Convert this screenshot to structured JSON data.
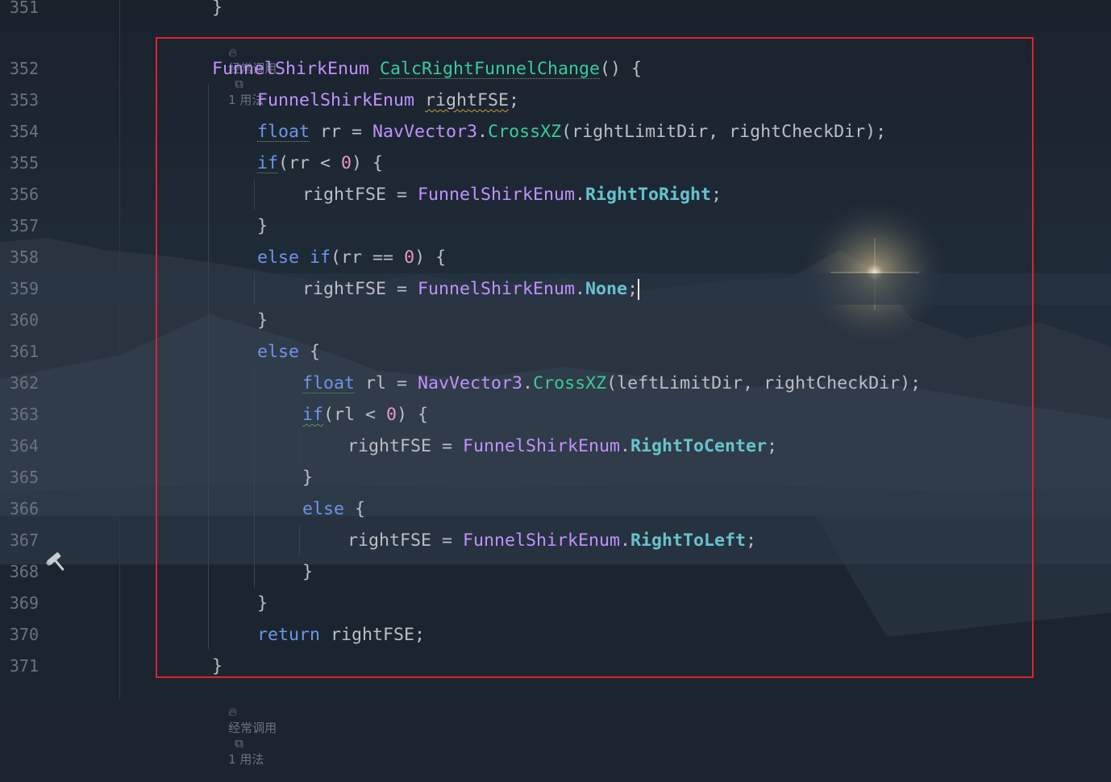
{
  "hints": [
    {
      "label": "经常调用",
      "usage": "1 用法"
    },
    {
      "label": "经常调用",
      "usage": "1 用法"
    }
  ],
  "lines": [
    {
      "num": "351",
      "text": "}"
    },
    {
      "num": "352",
      "text": "FunnelShirkEnum CalcRightFunnelChange() {"
    },
    {
      "num": "353",
      "text": "FunnelShirkEnum rightFSE;"
    },
    {
      "num": "354",
      "text": "float rr = NavVector3.CrossXZ(rightLimitDir, rightCheckDir);"
    },
    {
      "num": "355",
      "text": "if(rr < 0) {"
    },
    {
      "num": "356",
      "text": "rightFSE = FunnelShirkEnum.RightToRight;"
    },
    {
      "num": "357",
      "text": "}"
    },
    {
      "num": "358",
      "text": "else if(rr == 0) {"
    },
    {
      "num": "359",
      "text": "rightFSE = FunnelShirkEnum.None;"
    },
    {
      "num": "360",
      "text": "}"
    },
    {
      "num": "361",
      "text": "else {"
    },
    {
      "num": "362",
      "text": "float rl = NavVector3.CrossXZ(leftLimitDir, rightCheckDir);"
    },
    {
      "num": "363",
      "text": "if(rl < 0) {"
    },
    {
      "num": "364",
      "text": "rightFSE = FunnelShirkEnum.RightToCenter;"
    },
    {
      "num": "365",
      "text": "}"
    },
    {
      "num": "366",
      "text": "else {"
    },
    {
      "num": "367",
      "text": "rightFSE = FunnelShirkEnum.RightToLeft;"
    },
    {
      "num": "368",
      "text": "}"
    },
    {
      "num": "369",
      "text": "}"
    },
    {
      "num": "370",
      "text": "return rightFSE;"
    },
    {
      "num": "371",
      "text": "}"
    }
  ],
  "tokens": {
    "t352": [
      "FunnelShirkEnum",
      " ",
      "CalcRightFunnelChange",
      "() {"
    ],
    "t353": [
      "FunnelShirkEnum",
      " ",
      "rightFSE",
      ";"
    ],
    "t354": [
      "float",
      " rr = ",
      "NavVector3",
      ".",
      "CrossXZ",
      "(rightLimitDir, rightCheckDir);"
    ],
    "t355": [
      "if",
      "(rr < ",
      "0",
      ") {"
    ],
    "t356": [
      "rightFSE = ",
      "FunnelShirkEnum",
      ".",
      "RightToRight",
      ";"
    ],
    "t358": [
      "else",
      " ",
      "if",
      "(rr == ",
      "0",
      ") {"
    ],
    "t359": [
      "rightFSE = ",
      "FunnelShirkEnum",
      ".",
      "None",
      ";"
    ],
    "t361": [
      "else",
      " {"
    ],
    "t362": [
      "float",
      " rl = ",
      "NavVector3",
      ".",
      "CrossXZ",
      "(leftLimitDir, rightCheckDir);"
    ],
    "t363": [
      "if",
      "(rl < ",
      "0",
      ") {"
    ],
    "t364": [
      "rightFSE = ",
      "FunnelShirkEnum",
      ".",
      "RightToCenter",
      ";"
    ],
    "t366": [
      "else",
      " {"
    ],
    "t367": [
      "rightFSE = ",
      "FunnelShirkEnum",
      ".",
      "RightToLeft",
      ";"
    ],
    "t370": [
      "return",
      " rightFSE;"
    ]
  },
  "colors": {
    "highlight_border": "#e0212b",
    "keyword": "#6c95eb",
    "type": "#c191ff",
    "method": "#39cc9b",
    "enum_member": "#66c3cc",
    "number": "#ed94c0"
  },
  "icons": {
    "hint_icon": "flame-icon",
    "usage_icon": "link-icon",
    "gutter_icon": "hammer-icon"
  }
}
